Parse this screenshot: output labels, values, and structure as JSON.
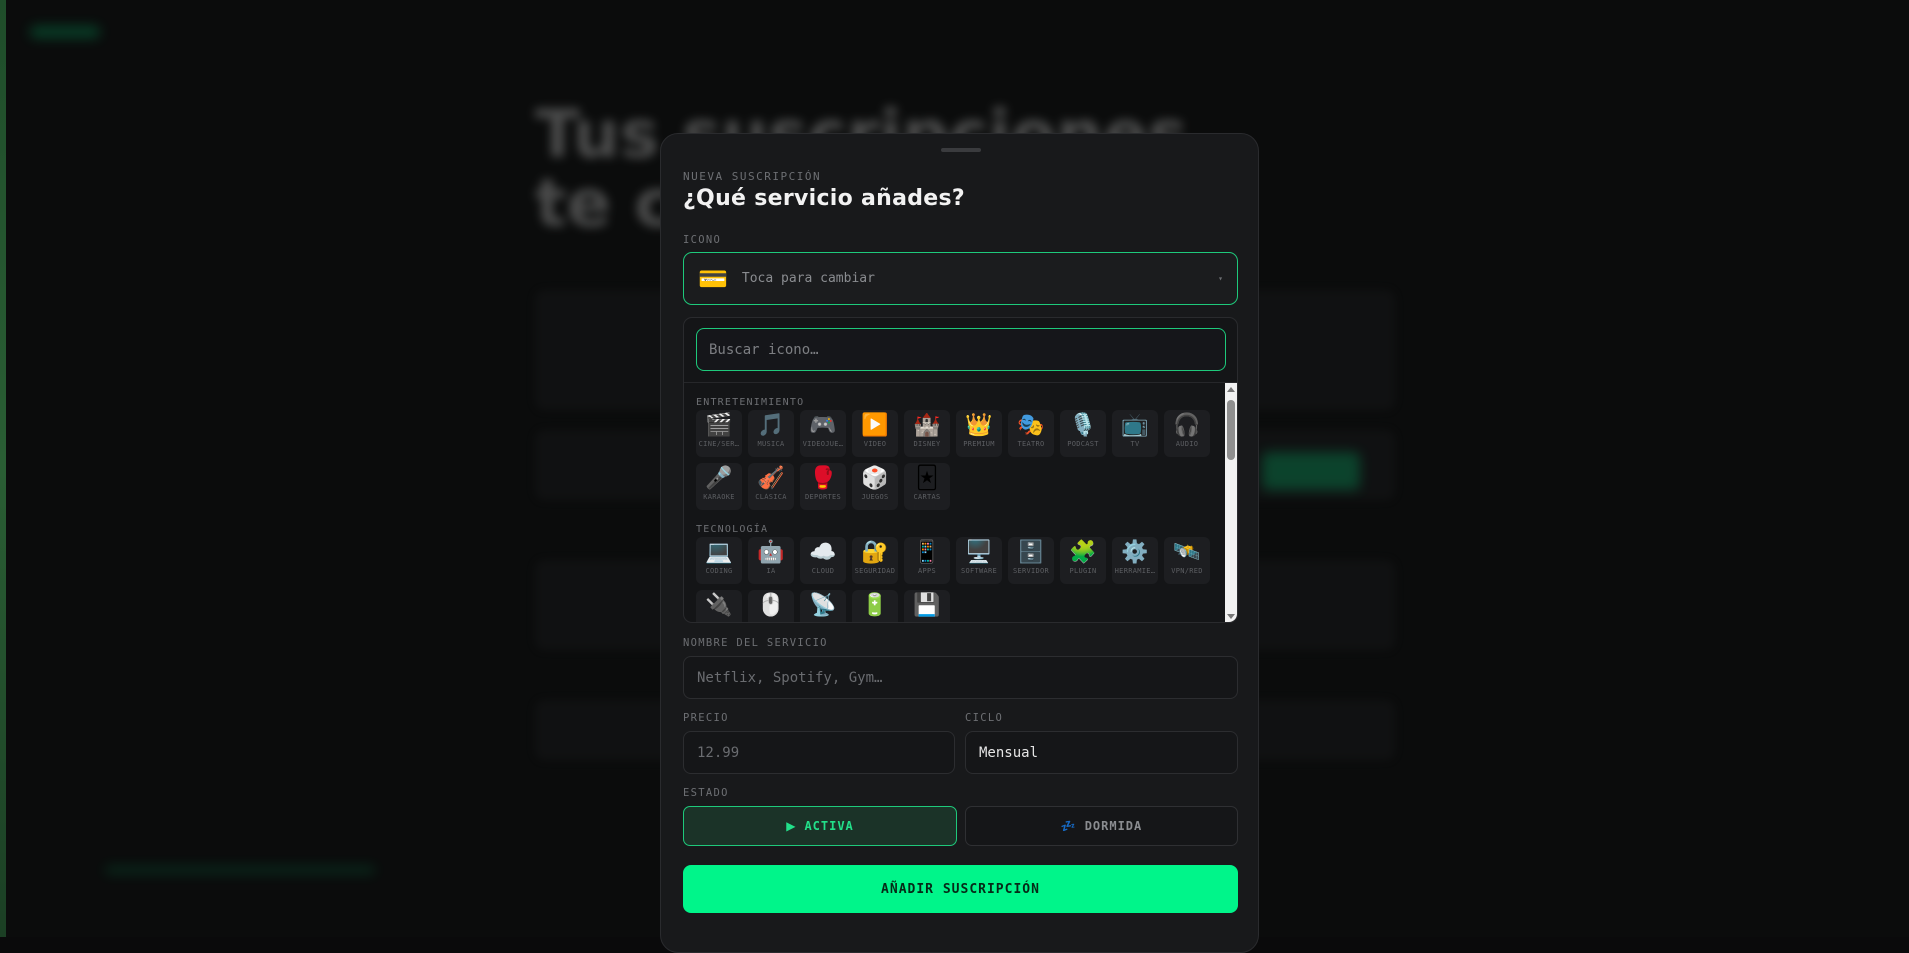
{
  "modal": {
    "eyebrow": "NUEVA SUSCRIPCIÓN",
    "title": "¿Qué servicio añades?"
  },
  "icon_field": {
    "label": "ICONO",
    "selected_icon": "💳",
    "hint": "Toca para cambiar",
    "caret": "▾"
  },
  "icon_picker": {
    "search_placeholder": "Buscar icono…",
    "categories": [
      {
        "name": "ENTRETENIMIENTO",
        "icons": [
          {
            "emoji": "🎬",
            "label": "CINE/SER…"
          },
          {
            "emoji": "🎵",
            "label": "MÚSICA"
          },
          {
            "emoji": "🎮",
            "label": "VIDEOJUE…"
          },
          {
            "emoji": "▶️",
            "label": "VÍDEO"
          },
          {
            "emoji": "🏰",
            "label": "DISNEY"
          },
          {
            "emoji": "👑",
            "label": "PREMIUM"
          },
          {
            "emoji": "🎭",
            "label": "TEATRO"
          },
          {
            "emoji": "🎙️",
            "label": "PODCAST"
          },
          {
            "emoji": "📺",
            "label": "TV"
          },
          {
            "emoji": "🎧",
            "label": "AUDIO"
          },
          {
            "emoji": "🎤",
            "label": "KARAOKE"
          },
          {
            "emoji": "🎻",
            "label": "CLÁSICA"
          },
          {
            "emoji": "🥊",
            "label": "DEPORTES"
          },
          {
            "emoji": "🎲",
            "label": "JUEGOS"
          },
          {
            "emoji": "🃏",
            "label": "CARTAS"
          }
        ]
      },
      {
        "name": "TECNOLOGÍA",
        "icons": [
          {
            "emoji": "💻",
            "label": "CODING"
          },
          {
            "emoji": "🤖",
            "label": "IA"
          },
          {
            "emoji": "☁️",
            "label": "CLOUD"
          },
          {
            "emoji": "🔐",
            "label": "SEGURIDAD"
          },
          {
            "emoji": "📱",
            "label": "APPS"
          },
          {
            "emoji": "🖥️",
            "label": "SOFTWARE"
          },
          {
            "emoji": "🗄️",
            "label": "SERVIDOR"
          },
          {
            "emoji": "🧩",
            "label": "PLUGIN"
          },
          {
            "emoji": "⚙️",
            "label": "HERRAMIE…"
          },
          {
            "emoji": "🛰️",
            "label": "VPN/RED"
          },
          {
            "emoji": "🔌",
            "label": ""
          },
          {
            "emoji": "🖱️",
            "label": ""
          },
          {
            "emoji": "📡",
            "label": ""
          },
          {
            "emoji": "🔋",
            "label": ""
          },
          {
            "emoji": "💾",
            "label": ""
          }
        ]
      }
    ]
  },
  "service_name": {
    "label": "NOMBRE DEL SERVICIO",
    "placeholder": "Netflix, Spotify, Gym…"
  },
  "price": {
    "label": "PRECIO",
    "placeholder": "12.99"
  },
  "cycle": {
    "label": "CICLO",
    "value": "Mensual"
  },
  "status": {
    "label": "ESTADO",
    "active": {
      "icon": "▶",
      "label": "ACTIVA"
    },
    "dormant": {
      "icon": "💤",
      "label": "DORMIDA"
    }
  },
  "submit_label": "AÑADIR SUSCRIPCIÓN",
  "colors": {
    "accent": "#00f58a",
    "accent_border": "#1ec97b",
    "modal_bg": "#18191b",
    "page_bg": "#0b0c0c"
  }
}
